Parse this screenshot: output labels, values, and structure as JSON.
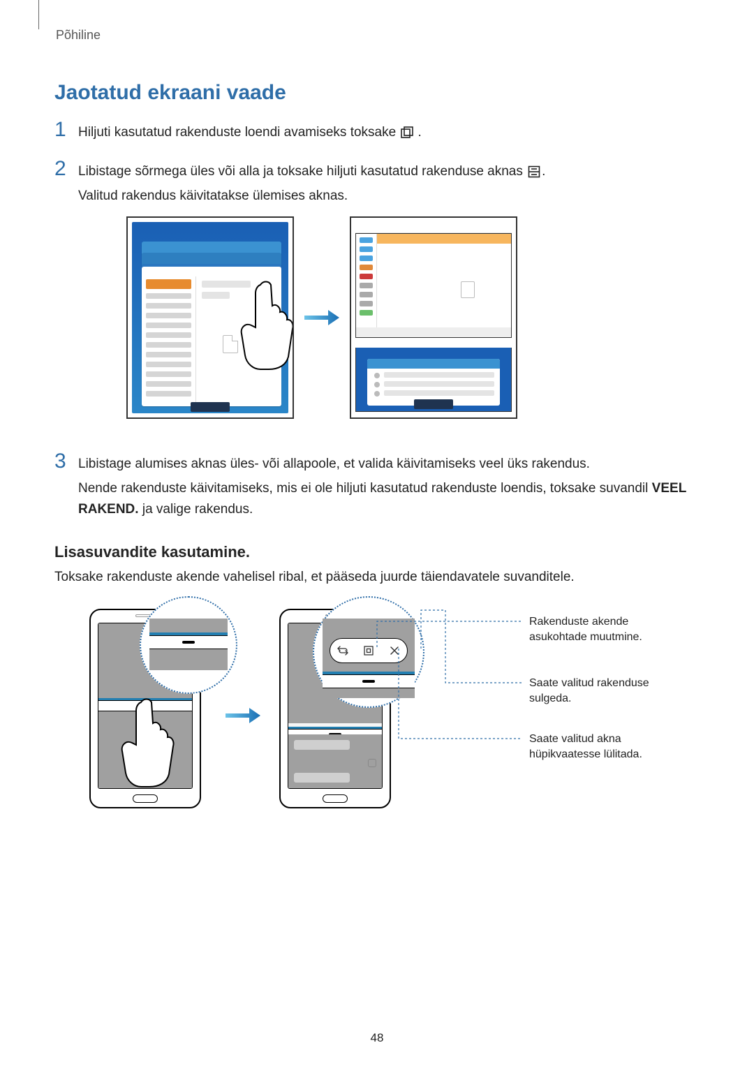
{
  "header": {
    "section": "Põhiline"
  },
  "heading": "Jaotatud ekraani vaade",
  "steps": {
    "s1": {
      "num": "1",
      "before_icon": "Hiljuti kasutatud rakenduste loendi avamiseks toksake ",
      "after_icon": ".",
      "icon_name": "recent-apps-icon"
    },
    "s2": {
      "num": "2",
      "line1_before": "Libistage sõrmega üles või alla ja toksake hiljuti kasutatud rakenduse aknas ",
      "line1_after": ".",
      "icon_name": "split-screen-icon",
      "line2": "Valitud rakendus käivitatakse ülemises aknas."
    },
    "s3": {
      "num": "3",
      "line1": "Libistage alumises aknas üles- või allapoole, et valida käivitamiseks veel üks rakendus.",
      "line2_pre": "Nende rakenduste käivitamiseks, mis ei ole hiljuti kasutatud rakenduste loendis, toksake suvandil ",
      "line2_bold": "VEEL RAKEND.",
      "line2_post": " ja valige rakendus."
    }
  },
  "subheading": "Lisasuvandite kasutamine.",
  "subbody": "Toksake rakenduste akende vahelisel ribal, et pääseda juurde täiendavatele suvanditele.",
  "annotations": {
    "a1": "Rakenduste akende asukohtade muutmine.",
    "a2": "Saate valitud rakenduse sulgeda.",
    "a3": "Saate valitud akna hüpikvaatesse lülitada."
  },
  "pill_icons": {
    "swap": "swap-windows-icon",
    "popup": "popup-view-icon",
    "close": "close-window-icon"
  },
  "page_number": "48"
}
